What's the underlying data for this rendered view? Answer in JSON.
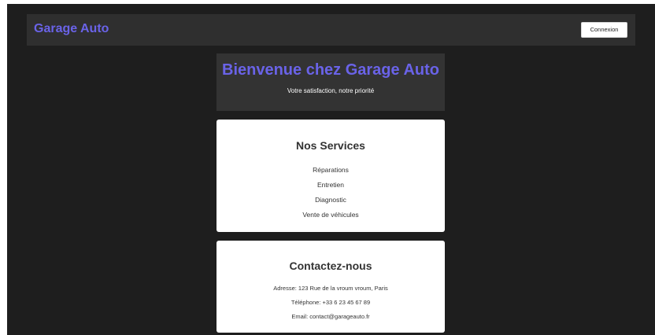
{
  "header": {
    "brand": "Garage Auto",
    "login_label": "Connexion"
  },
  "hero": {
    "title": "Bienvenue chez Garage Auto",
    "subtitle": "Votre satisfaction, notre priorité"
  },
  "services": {
    "title": "Nos Services",
    "items": [
      "Réparations",
      "Entretien",
      "Diagnostic",
      "Vente de véhicules"
    ]
  },
  "contact": {
    "title": "Contactez-nous",
    "address": "Adresse: 123 Rue de la vroum vroum, Paris",
    "phone": "Téléphone: +33 6 23 45 67 89",
    "email": "Email: contact@garageauto.fr"
  },
  "colors": {
    "accent": "#6a63e8",
    "background": "#1e1e1e",
    "header_bg": "#2f2f2f",
    "hero_bg": "#333333",
    "card_bg": "#ffffff"
  }
}
